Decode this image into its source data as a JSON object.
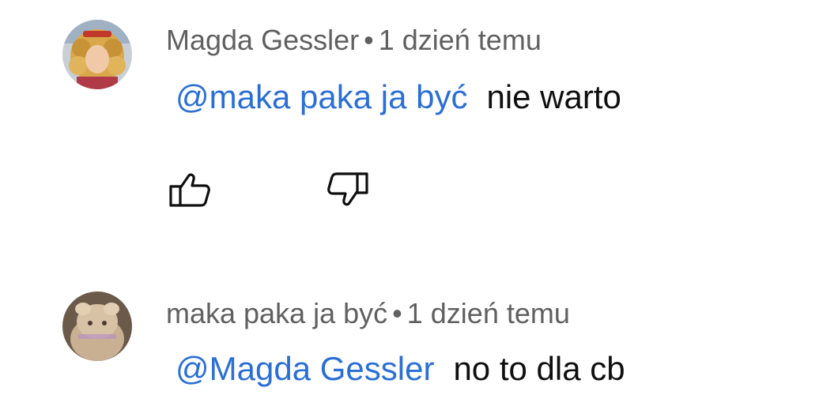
{
  "comments": [
    {
      "author": "Magda Gessler",
      "separator": "•",
      "time": "1 dzień temu",
      "mention": "@maka paka ja być",
      "text": "nie warto",
      "avatar_icon": "avatar-curly-hair"
    },
    {
      "author": "maka paka ja być",
      "separator": "•",
      "time": "1 dzień temu",
      "mention": "@Magda Gessler",
      "text": "no to dla cb",
      "avatar_icon": "avatar-figurine"
    }
  ],
  "actions": {
    "like_icon": "thumbs-up-icon",
    "dislike_icon": "thumbs-down-icon"
  },
  "colors": {
    "mention": "#2a6fd6",
    "meta": "#606060",
    "text": "#0f0f0f"
  }
}
